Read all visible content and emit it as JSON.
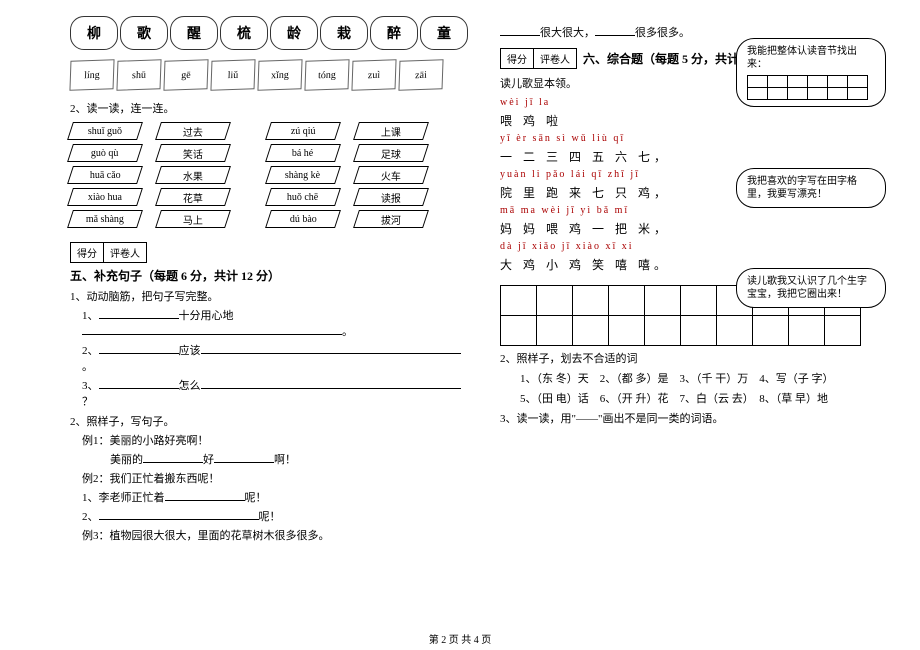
{
  "clouds": [
    "柳",
    "歌",
    "醒",
    "梳",
    "龄",
    "栽",
    "醉",
    "童"
  ],
  "post_cloud_1": "很大很大，",
  "post_cloud_2": "很多很多。",
  "leaves": [
    "líng",
    "shū",
    "gē",
    "liǔ",
    "xǐng",
    "tóng",
    "zuì",
    "zāi"
  ],
  "q2_label": "2、读一读，连一连。",
  "match_left_pinyin": [
    "shuǐ guǒ",
    "guò qù",
    "huā cǎo",
    "xiào hua",
    "mǎ shàng"
  ],
  "match_left_cn": [
    "过去",
    "笑话",
    "水果",
    "花草",
    "马上"
  ],
  "match_right_pinyin": [
    "zú qiú",
    "bá hé",
    "shàng kè",
    "huǒ chē",
    "dú bào"
  ],
  "match_right_cn": [
    "上课",
    "足球",
    "火车",
    "读报",
    "拔河"
  ],
  "score": {
    "a": "得分",
    "b": "评卷人"
  },
  "sec5_title": "五、补充句子（每题 6 分，共计 12 分）",
  "sec5_q1": "1、动动脑筋，把句子写完整。",
  "sec5_1_1": {
    "pre": "1、",
    "mid": "十分用心地",
    "post": "。"
  },
  "sec5_1_2": {
    "pre": "2、",
    "mid": "应该",
    "post": "。"
  },
  "sec5_1_3": {
    "pre": "3、",
    "mid": "怎么",
    "post": "？"
  },
  "sec5_q2": "2、照样子，写句子。",
  "sec5_ex1_a": "例1：美丽的小路好亮啊！",
  "sec5_ex1_b": "美丽的",
  "sec5_ex1_c": "好",
  "sec5_ex1_d": "啊！",
  "sec5_ex2": "例2：我们正忙着搬东西呢！",
  "sec5_2_1": "1、李老师正忙着",
  "sec5_2_1b": "呢！",
  "sec5_2_2": "2、",
  "sec5_2_2b": "呢！",
  "sec5_ex3": "例3：植物园很大很大，里面的花草树木很多很多。",
  "sec6_title": "六、综合题（每题 5 分，共计 20 分）",
  "sec6_intro": "读儿歌显本领。",
  "rhyme": [
    {
      "pin": "wèi  jī  la",
      "cn": "喂  鸡  啦"
    },
    {
      "pin": "yī  èr  sān  sì  wǔ  liù  qī",
      "cn": "一 二 三 四 五 六 七，"
    },
    {
      "pin": "yuàn  li  pǎo  lái  qī  zhī  jī",
      "cn": "院  里  跑  来  七 只 鸡，"
    },
    {
      "pin": "mā  ma  wèi  jī  yì bǎ mǐ",
      "cn": "妈  妈  喂  鸡  一 把 米，"
    },
    {
      "pin": "dà  jī  xiǎo  jī  xiào  xī  xi",
      "cn": "大  鸡  小 鸡 笑 嘻 嘻。"
    }
  ],
  "bubble1": "我能把整体认读音节找出来：",
  "bubble2": "我把喜欢的字写在田字格里，我要写漂亮！",
  "bubble3": "读儿歌我又认识了几个生字宝宝，我把它圈出来！",
  "sec6_q2": "2、照样子，划去不合适的词",
  "sec6_q2_items": "1、（东 冬）天　2、（都 多）是　3、（千 干）万　4、写（子 字）",
  "sec6_q2_items2": "5、（田 电）话　6、（开 升）花　7、白（云 去）　8、（草 早）地",
  "sec6_q3": "3、读一读，用\"——\"画出不是同一类的词语。",
  "footer": "第 2 页 共 4 页"
}
